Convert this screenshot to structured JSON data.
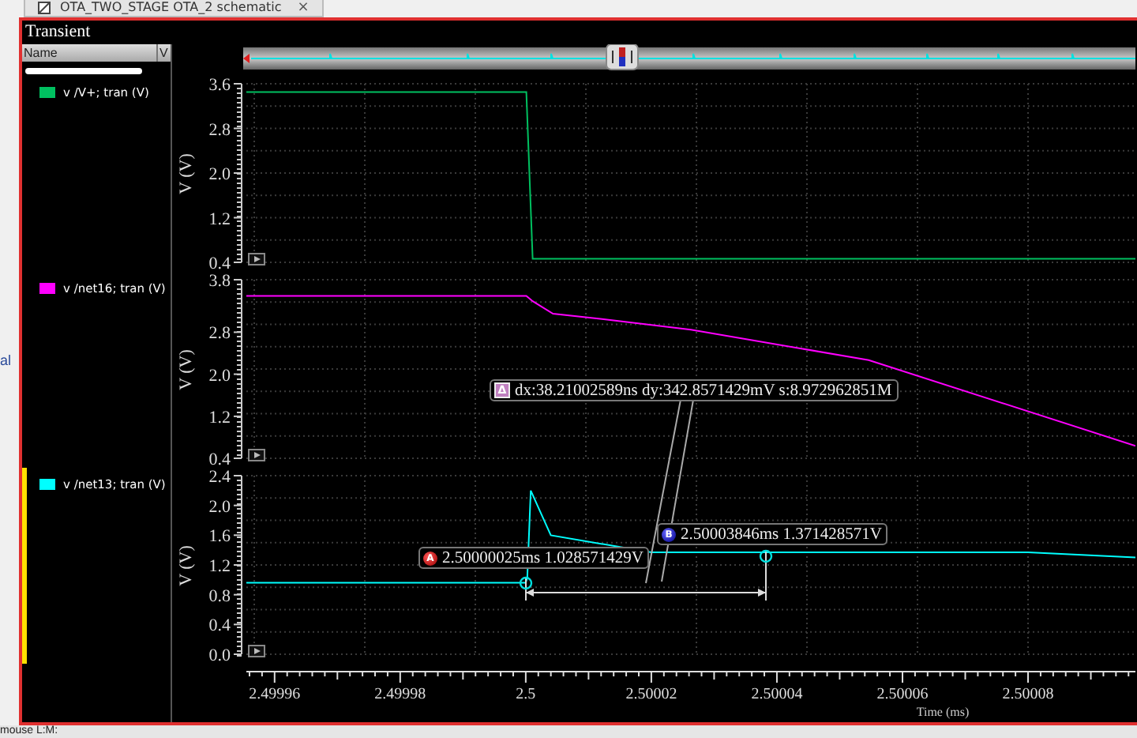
{
  "tab": {
    "title": "OTA_TWO_STAGE OTA_2 schematic",
    "close": "×"
  },
  "background_text": "al",
  "panel": {
    "title": "Transient"
  },
  "sidebar": {
    "columns": [
      "Name",
      "V"
    ],
    "signals": [
      {
        "name": "v /V+; tran (V)",
        "color": "#00c060",
        "selected": false
      },
      {
        "name": "v /net16; tran (V)",
        "color": "#ff00ff",
        "selected": false
      },
      {
        "name": "v /net13; tran (V)",
        "color": "#00ffff",
        "selected": true
      }
    ]
  },
  "strips": [
    {
      "ylabel": "V (V)",
      "y_tick_labels": [
        "3.6",
        "2.8",
        "2.0",
        "1.2",
        "0.4"
      ],
      "color": "#00c060"
    },
    {
      "ylabel": "V (V)",
      "y_tick_labels": [
        "3.8",
        "2.8",
        "2.0",
        "1.2",
        "0.4"
      ],
      "color": "#ff00ff"
    },
    {
      "chart_data": {
        "type": "line",
        "grid": true,
        "xlabel": "Time (ms)",
        "ylabel": "V (V)",
        "xlim": [
          2.4999555,
          2.5000971
        ],
        "ylim": [
          0,
          2.4
        ],
        "yticks": [
          {
            "value": 0,
            "label": "0.0"
          },
          {
            "value": 0.4,
            "label": "0.4"
          },
          {
            "value": 0.8,
            "label": "0.8"
          },
          {
            "value": 1.2,
            "label": "1.2"
          },
          {
            "value": 1.6,
            "label": "1.6"
          },
          {
            "value": 2,
            "label": "2.0"
          },
          {
            "value": 2.4,
            "label": "2.4"
          }
        ],
        "xticks": [
          {
            "value": 2.49996,
            "label": "2.49996"
          },
          {
            "value": 2.49998,
            "label": "2.49998"
          },
          {
            "value": 2.5,
            "label": "2.5"
          },
          {
            "value": 2.50002,
            "label": "2.50002"
          },
          {
            "value": 2.50004,
            "label": "2.50004"
          },
          {
            "value": 2.50006,
            "label": "2.50006"
          },
          {
            "value": 2.50008,
            "label": "2.50008"
          }
        ],
        "x": [
          2.4999555,
          2.5,
          2.50000025,
          2.5000008,
          2.500004,
          2.50002,
          2.5000385,
          2.50006,
          2.50008,
          2.5000971
        ],
        "series": [
          {
            "color": "#00ffff",
            "values": [
              0.96,
              0.96,
              1.03,
              2.2,
              1.6,
              1.37,
              1.37,
              1.37,
              1.37,
              1.3
            ]
          }
        ]
      }
    }
  ],
  "markers": [
    {
      "kind": "delta",
      "letter": "Δ",
      "text": "dx:38.21002589ns dy:342.8571429mV s:8.972962851M"
    },
    {
      "kind": "B",
      "letter": "B",
      "text": "2.50003846ms 1.371428571V"
    },
    {
      "kind": "A",
      "letter": "A",
      "text": "2.50000025ms 1.028571429V"
    }
  ],
  "status_bar": {
    "left": "mouse L:",
    "middle": "M:"
  }
}
